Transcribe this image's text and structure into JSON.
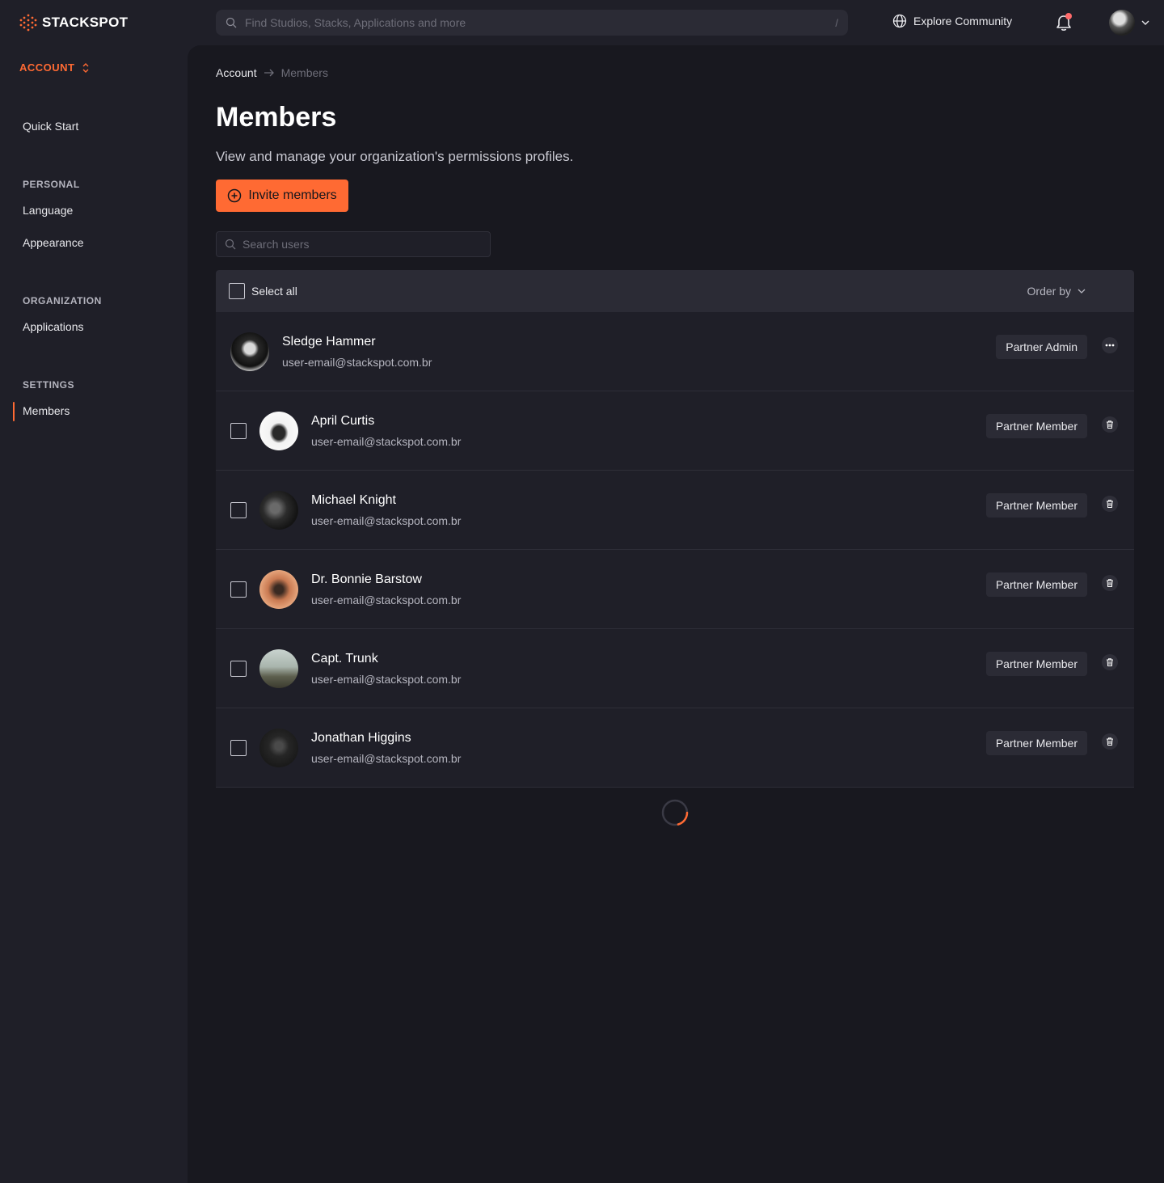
{
  "brand": {
    "name": "STACKSPOT",
    "accent": "#ff6a33"
  },
  "topbar": {
    "search_placeholder": "Find Studios, Stacks, Applications and more",
    "search_shortcut": "/",
    "explore_label": "Explore Community",
    "notification_dot_color": "#ff6b6b"
  },
  "sidebar": {
    "account_switcher": "ACCOUNT",
    "quick_start": "Quick Start",
    "personal_heading": "PERSONAL",
    "language": "Language",
    "appearance": "Appearance",
    "organization_heading": "ORGANIZATION",
    "applications": "Applications",
    "settings_heading": "SETTINGS",
    "members": "Members",
    "active_item": "Members"
  },
  "main": {
    "breadcrumb": {
      "root": "Account",
      "current": "Members"
    },
    "title": "Members",
    "description": "View and manage your organization's permissions profiles.",
    "invite_button": "Invite members",
    "user_search_placeholder": "Search users"
  },
  "table": {
    "select_all_label": "Select all",
    "order_by_label": "Order by",
    "rows": [
      {
        "name": "Sledge Hammer",
        "email": "user-email@stackspot.com.br",
        "role": "Partner Admin",
        "action_icon": "more-icon",
        "has_checkbox": false
      },
      {
        "name": "April Curtis",
        "email": "user-email@stackspot.com.br",
        "role": "Partner Member",
        "action_icon": "trash-icon",
        "has_checkbox": true
      },
      {
        "name": "Michael Knight",
        "email": "user-email@stackspot.com.br",
        "role": "Partner Member",
        "action_icon": "trash-icon",
        "has_checkbox": true
      },
      {
        "name": "Dr. Bonnie Barstow",
        "email": "user-email@stackspot.com.br",
        "role": "Partner Member",
        "action_icon": "trash-icon",
        "has_checkbox": true
      },
      {
        "name": "Capt. Trunk",
        "email": "user-email@stackspot.com.br",
        "role": "Partner Member",
        "action_icon": "trash-icon",
        "has_checkbox": true
      },
      {
        "name": "Jonathan Higgins",
        "email": "user-email@stackspot.com.br",
        "role": "Partner Member",
        "action_icon": "trash-icon",
        "has_checkbox": true
      }
    ]
  }
}
